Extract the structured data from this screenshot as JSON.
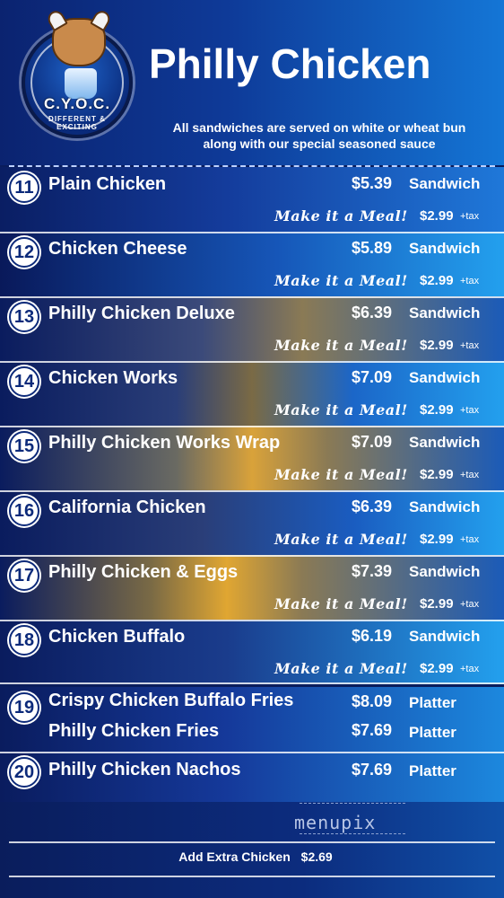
{
  "header": {
    "logo_text": "C.Y.O.C.",
    "logo_sub": "DIFFERENT & EXCITING",
    "title": "Philly Chicken",
    "subtitle_line1": "All sandwiches are served on white or wheat bun",
    "subtitle_line2": "along with our special seasoned sauce"
  },
  "meal_label": "Make it a Meal!",
  "meal_price": "$2.99",
  "tax_label": "+tax",
  "items": [
    {
      "num": "11",
      "name": "Plain Chicken",
      "price": "$5.39",
      "unit": "Sandwich"
    },
    {
      "num": "12",
      "name": "Chicken Cheese",
      "price": "$5.89",
      "unit": "Sandwich"
    },
    {
      "num": "13",
      "name": "Philly Chicken Deluxe",
      "price": "$6.39",
      "unit": "Sandwich"
    },
    {
      "num": "14",
      "name": "Chicken Works",
      "price": "$7.09",
      "unit": "Sandwich"
    },
    {
      "num": "15",
      "name": "Philly Chicken Works Wrap",
      "price": "$7.09",
      "unit": "Sandwich"
    },
    {
      "num": "16",
      "name": "California Chicken",
      "price": "$6.39",
      "unit": "Sandwich"
    },
    {
      "num": "17",
      "name": "Philly Chicken & Eggs",
      "price": "$7.39",
      "unit": "Sandwich"
    },
    {
      "num": "18",
      "name": "Chicken Buffalo",
      "price": "$6.19",
      "unit": "Sandwich"
    }
  ],
  "platters": [
    {
      "num": "19",
      "name": "Crispy Chicken Buffalo Fries",
      "price": "$8.09",
      "unit": "Platter"
    },
    {
      "num": "",
      "name": "Philly Chicken Fries",
      "price": "$7.69",
      "unit": "Platter"
    },
    {
      "num": "20",
      "name": "Philly Chicken Nachos",
      "price": "$7.69",
      "unit": "Platter"
    }
  ],
  "watermark": "menupix",
  "footer": {
    "extra_label": "Add Extra Chicken",
    "extra_price": "$2.69"
  }
}
